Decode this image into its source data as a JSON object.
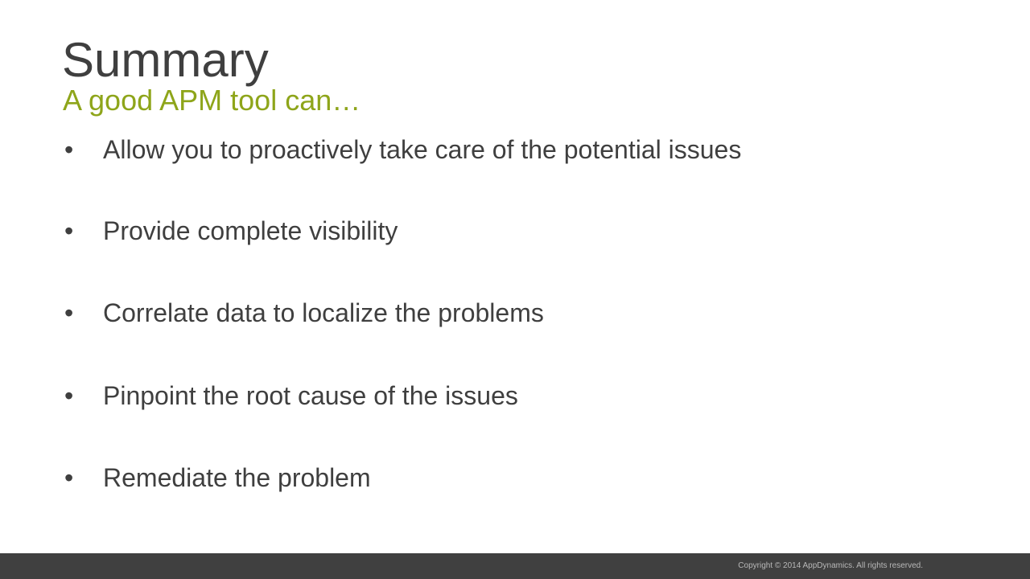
{
  "slide": {
    "title": "Summary",
    "subtitle": "A good APM tool can…",
    "bullet_glyph": "•",
    "bullets": [
      "Allow you to proactively take care of the potential issues",
      "Provide complete visibility",
      "Correlate data to localize the problems",
      "Pinpoint the root cause of the issues",
      "Remediate the problem"
    ]
  },
  "footer": {
    "copyright": "Copyright © 2014 AppDynamics. All rights reserved."
  },
  "colors": {
    "title": "#3f3f3f",
    "subtitle_accent": "#8ea51a",
    "body_text": "#3f3f3f",
    "footer_bar": "#404040",
    "footer_text": "#b8b8b8"
  }
}
